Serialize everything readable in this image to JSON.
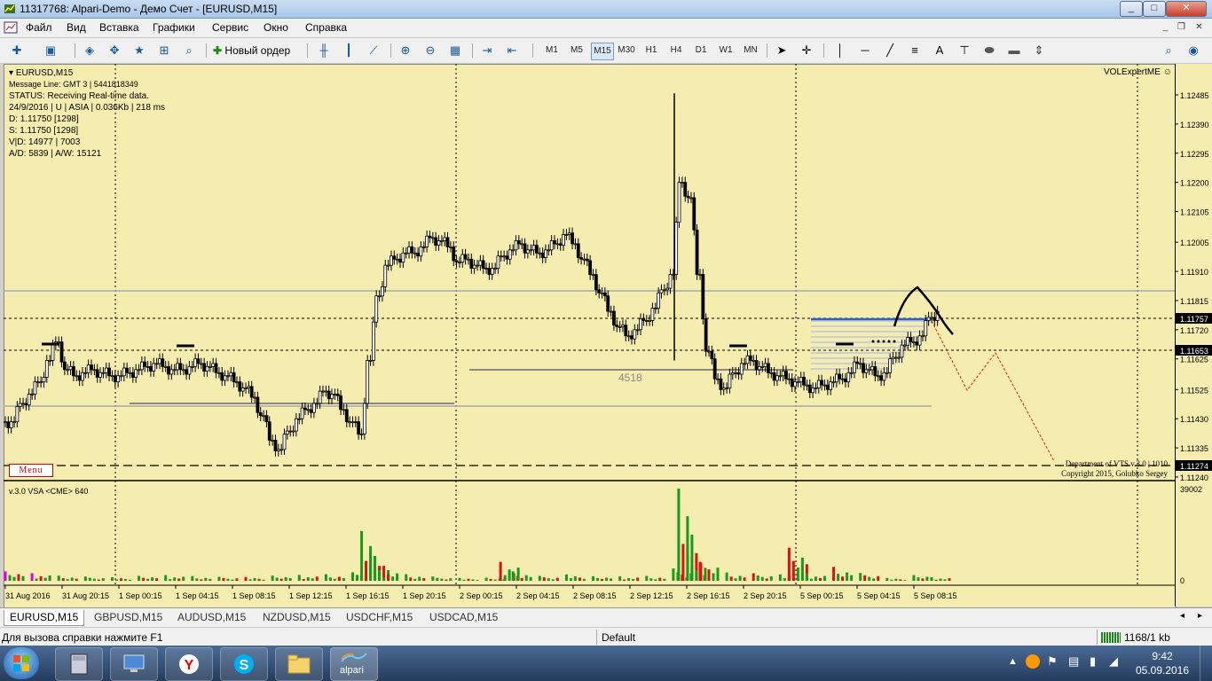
{
  "window": {
    "title": "11317768: Alpari-Demo - Демо Счет - [EURUSD,M15]"
  },
  "menu": [
    "Файл",
    "Вид",
    "Вставка",
    "Графики",
    "Сервис",
    "Окно",
    "Справка"
  ],
  "toolbar": {
    "new_order_label": "Новый ордер",
    "timeframes": [
      "M1",
      "M5",
      "M15",
      "M30",
      "H1",
      "H4",
      "D1",
      "W1",
      "MN"
    ],
    "active_timeframe": "M15",
    "text_tool": "A"
  },
  "chart": {
    "symbol_header": "EURUSD,M15",
    "info_lines": [
      "Message Line: GMT 3 | 5441818349",
      "STATUS:  Receiving Real-time data.",
      "24/9/2016 | U | ASIA | 0.036Kb | 218 ms",
      "D: 1.11750  [1298]",
      "S: 1.11750  [1298]",
      "V|D: 14977 | 7003",
      "A/D: 5839 | A/W: 15121"
    ],
    "expert_label": "VOLExpertME",
    "menu_badge": "Menu",
    "level_label": "4518",
    "copyright_lines": [
      "Department of VTS  v.3.0 | 1010",
      "Copyright 2015, Golubko Sergey"
    ],
    "indicator_label": "v.3.0 VSA <CME> 640",
    "indicator_max": "39002",
    "indicator_min": "0"
  },
  "chart_data": {
    "type": "line",
    "series": [
      {
        "name": "EURUSD,M15",
        "x": [
          0,
          10,
          20,
          30,
          40,
          50,
          60,
          70,
          80,
          90,
          100,
          110,
          120,
          130,
          140,
          150,
          160,
          170,
          180,
          190,
          200,
          210,
          220,
          230,
          240,
          250,
          260,
          270,
          280,
          290,
          300,
          310,
          320,
          330,
          340,
          350,
          360,
          370,
          380,
          390,
          400,
          410,
          420,
          430,
          440,
          450,
          460,
          470,
          480,
          490,
          500,
          510,
          520,
          530,
          540,
          550,
          560,
          570,
          580,
          590,
          600,
          610,
          620,
          630,
          640,
          650,
          660,
          670,
          680,
          690,
          700,
          710,
          720,
          730,
          740,
          750,
          760,
          770,
          780,
          790,
          800,
          810,
          820,
          830,
          840,
          850,
          860,
          870,
          880,
          890,
          900,
          910,
          920,
          930,
          940,
          950,
          960,
          970,
          980,
          990,
          1000,
          1010,
          1020,
          1030,
          1040
        ],
        "y": [
          1.1142,
          1.1148,
          1.1151,
          1.1155,
          1.1162,
          1.1168,
          1.1159,
          1.1157,
          1.1158,
          1.1159,
          1.1158,
          1.1157,
          1.1157,
          1.1158,
          1.1159,
          1.116,
          1.1161,
          1.116,
          1.1159,
          1.1159,
          1.116,
          1.1161,
          1.116,
          1.1158,
          1.1157,
          1.1155,
          1.1153,
          1.115,
          1.1144,
          1.1136,
          1.1133,
          1.1139,
          1.1143,
          1.1146,
          1.1148,
          1.1152,
          1.1151,
          1.1146,
          1.1142,
          1.1138,
          1.1162,
          1.1183,
          1.1193,
          1.1195,
          1.1197,
          1.1197,
          1.1199,
          1.1202,
          1.1201,
          1.1199,
          1.1194,
          1.1195,
          1.1193,
          1.1192,
          1.1192,
          1.1196,
          1.1198,
          1.12,
          1.1198,
          1.1197,
          1.1198,
          1.12,
          1.1203,
          1.12,
          1.1195,
          1.119,
          1.1184,
          1.1178,
          1.1173,
          1.117,
          1.1172,
          1.1175,
          1.1179,
          1.1185,
          1.119,
          1.122,
          1.1215,
          1.119,
          1.1165,
          1.1156,
          1.1153,
          1.1158,
          1.1161,
          1.1162,
          1.116,
          1.1158,
          1.1157,
          1.1156,
          1.1155,
          1.1154,
          1.1153,
          1.1154,
          1.1155,
          1.1156,
          1.1158,
          1.1161,
          1.1159,
          1.1157,
          1.1158,
          1.1163,
          1.1167,
          1.1168,
          1.117,
          1.1176,
          1.1178
        ]
      },
      {
        "name": "v.3.0 VSA <CME> 640",
        "x": [
          0,
          30,
          60,
          90,
          120,
          150,
          180,
          210,
          240,
          270,
          300,
          330,
          360,
          390,
          400,
          410,
          420,
          450,
          480,
          510,
          540,
          556,
          570,
          600,
          630,
          660,
          690,
          720,
          750,
          756,
          766,
          780,
          810,
          840,
          870,
          880,
          900,
          930,
          960,
          990,
          1020,
          1040
        ],
        "y": [
          4000,
          3200,
          2200,
          1800,
          1500,
          2100,
          2400,
          2000,
          1700,
          1600,
          2200,
          2500,
          2800,
          3600,
          21000,
          9000,
          4500,
          2800,
          1800,
          1200,
          1300,
          8000,
          4000,
          2100,
          2700,
          1900,
          1900,
          2100,
          5200,
          39000,
          11000,
          8000,
          3500,
          3200,
          2700,
          14000,
          2900,
          5900,
          3300,
          1200,
          2400,
          1500
        ]
      }
    ],
    "xlabel": "",
    "ylabel": "",
    "x_tick_labels": [
      "31 Aug 2016",
      "31 Aug 20:15",
      "1 Sep 00:15",
      "1 Sep 04:15",
      "1 Sep 08:15",
      "1 Sep 12:15",
      "1 Sep 16:15",
      "1 Sep 20:15",
      "2 Sep 00:15",
      "2 Sep 04:15",
      "2 Sep 08:15",
      "2 Sep 12:15",
      "2 Sep 16:15",
      "2 Sep 20:15",
      "5 Sep 00:15",
      "5 Sep 04:15",
      "5 Sep 08:15"
    ],
    "y_tick_labels": [
      "1.12485",
      "1.12390",
      "1.12295",
      "1.12200",
      "1.12105",
      "1.12005",
      "1.11910",
      "1.11815",
      "1.11720",
      "1.11625",
      "1.11525",
      "1.11430",
      "1.11335",
      "1.11240"
    ],
    "y_min": 1.1124,
    "y_max": 1.12485,
    "markers": [
      "1.11757",
      "1.11653",
      "1.11274"
    ],
    "grid": false
  },
  "colors": {
    "chart_bg": "#f5ecb0",
    "candle": "#000000",
    "volume_green": "#1a9a1a",
    "volume_red": "#e01010",
    "volume_magenta": "#e000e0",
    "level_line": "#3060d0",
    "forecast": "#e02020"
  },
  "tabs": [
    "EURUSD,M15",
    "GBPUSD,M15",
    "AUDUSD,M15",
    "NZDUSD,M15",
    "USDCHF,M15",
    "USDCAD,M15"
  ],
  "active_tab": "EURUSD,M15",
  "status": {
    "help": "Для вызова справки нажмите F1",
    "profile": "Default",
    "traffic": "1168/1 kb"
  },
  "taskbar": {
    "apps": [
      "calculator-icon",
      "remote-desktop-icon",
      "yandex-icon",
      "skype-icon",
      "explorer-icon",
      "alpari-icon"
    ],
    "alpari_label": "alpari",
    "clock_time": "9:42",
    "clock_date": "05.09.2016"
  }
}
